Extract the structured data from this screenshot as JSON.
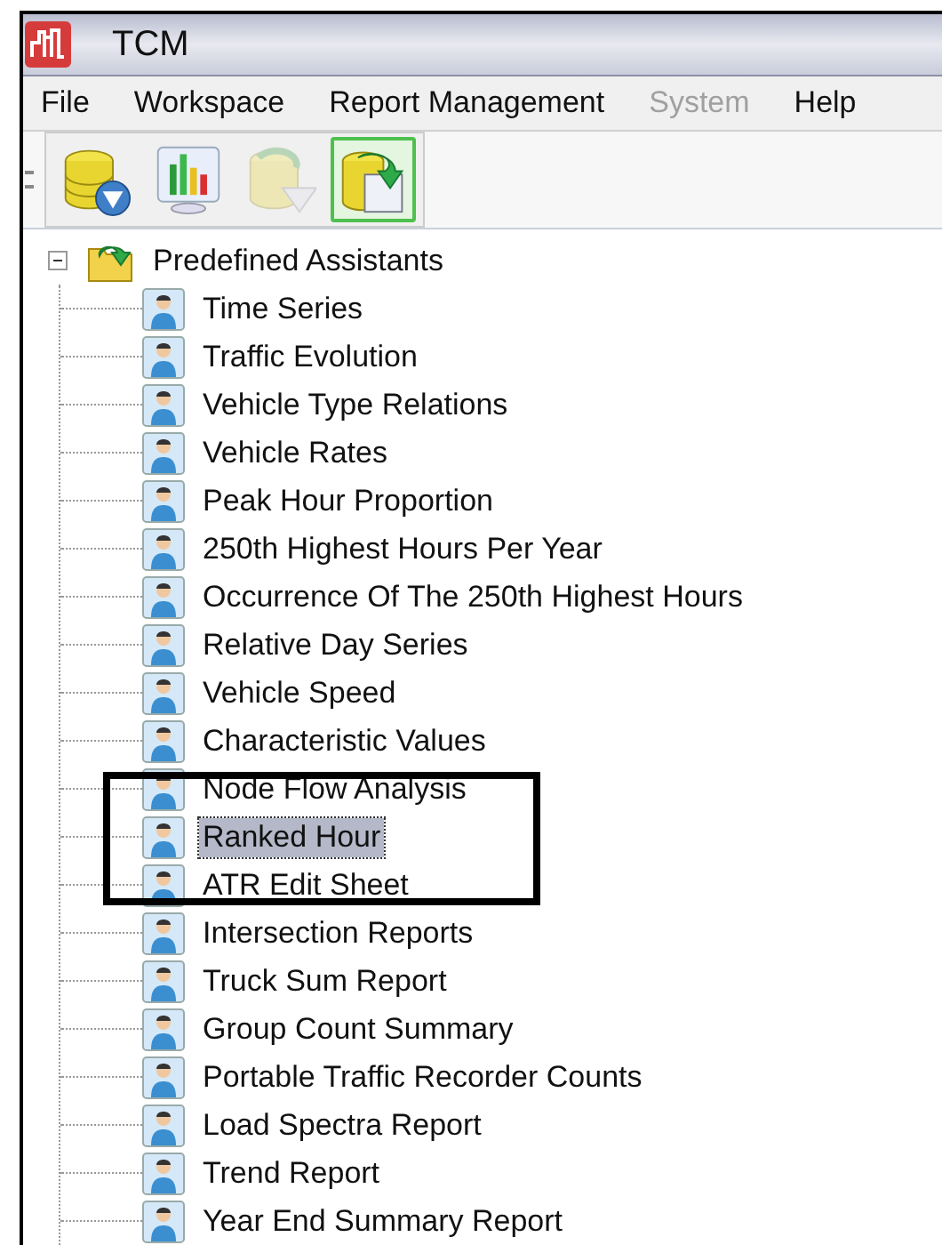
{
  "window": {
    "title": "TCM"
  },
  "menu": [
    {
      "label": "File",
      "disabled": false
    },
    {
      "label": "Workspace",
      "disabled": false
    },
    {
      "label": "Report Management",
      "disabled": false
    },
    {
      "label": "System",
      "disabled": true
    },
    {
      "label": "Help",
      "disabled": false
    }
  ],
  "toolbar": [
    {
      "kind": "database-filter",
      "disabled": false,
      "selected": false
    },
    {
      "kind": "chart",
      "disabled": false,
      "selected": false
    },
    {
      "kind": "refresh-filter",
      "disabled": true,
      "selected": false
    },
    {
      "kind": "database-export",
      "disabled": false,
      "selected": true
    }
  ],
  "tree": {
    "label": "Predefined Assistants",
    "expanded": true,
    "children": [
      {
        "label": "Time Series",
        "selected": false,
        "highlighted": false
      },
      {
        "label": "Traffic Evolution",
        "selected": false,
        "highlighted": false
      },
      {
        "label": "Vehicle Type Relations",
        "selected": false,
        "highlighted": false
      },
      {
        "label": "Vehicle Rates",
        "selected": false,
        "highlighted": false
      },
      {
        "label": "Peak Hour Proportion",
        "selected": false,
        "highlighted": false
      },
      {
        "label": "250th Highest Hours Per Year",
        "selected": false,
        "highlighted": false
      },
      {
        "label": "Occurrence Of The 250th Highest Hours",
        "selected": false,
        "highlighted": false
      },
      {
        "label": "Relative Day Series",
        "selected": false,
        "highlighted": false
      },
      {
        "label": "Vehicle Speed",
        "selected": false,
        "highlighted": false
      },
      {
        "label": "Characteristic Values",
        "selected": false,
        "highlighted": false
      },
      {
        "label": "Node Flow Analysis",
        "selected": false,
        "highlighted": true
      },
      {
        "label": "Ranked Hour",
        "selected": true,
        "highlighted": true
      },
      {
        "label": "ATR Edit Sheet",
        "selected": false,
        "highlighted": true
      },
      {
        "label": "Intersection Reports",
        "selected": false,
        "highlighted": false
      },
      {
        "label": "Truck Sum Report",
        "selected": false,
        "highlighted": false
      },
      {
        "label": "Group Count Summary",
        "selected": false,
        "highlighted": false
      },
      {
        "label": "Portable Traffic Recorder Counts",
        "selected": false,
        "highlighted": false
      },
      {
        "label": "Load Spectra Report",
        "selected": false,
        "highlighted": false
      },
      {
        "label": "Trend Report",
        "selected": false,
        "highlighted": false
      },
      {
        "label": "Year End Summary Report",
        "selected": false,
        "highlighted": false
      }
    ]
  }
}
